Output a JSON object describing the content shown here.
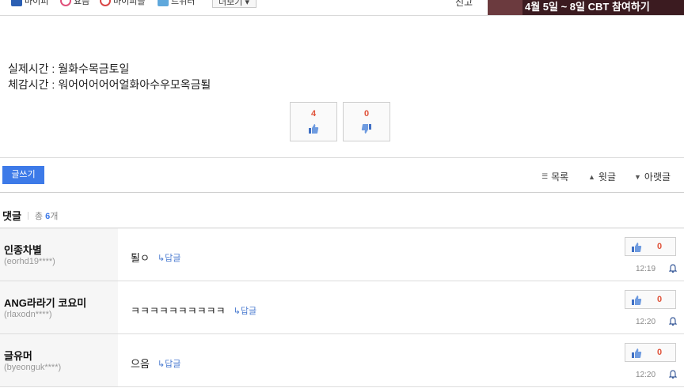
{
  "share_bar": {
    "items": [
      "마이피",
      "요즘",
      "마이피플",
      "트위터"
    ],
    "more_label": "더보기",
    "report_label": "신고"
  },
  "banner": {
    "text": "4월 5일 ~ 8일 CBT 참여하기"
  },
  "post": {
    "lines": [
      "실제시간 : 월화수목금토일",
      "체감시간 : 워어어어어어얼화아수우모옥금퇼"
    ]
  },
  "votes": {
    "up": "4",
    "down": "0"
  },
  "toolbar": {
    "write_label": "글쓰기",
    "list_label": "목록",
    "prev_label": "윗글",
    "next_label": "아랫글"
  },
  "comments_header": {
    "title": "댓글",
    "total_prefix": "총",
    "count": "6",
    "unit": "개"
  },
  "comments": [
    {
      "nick": "인종차별",
      "uid": "(eorhd19****)",
      "text": "퇼ㅇ",
      "reply": "↳답글",
      "likes": "0",
      "time": "12:19"
    },
    {
      "nick": "ANG라라기 코요미",
      "uid": "(rlaxodn****)",
      "text": "ㅋㅋㅋㅋㅋㅋㅋㅋㅋㅋ",
      "reply": "↳답글",
      "likes": "0",
      "time": "12:20"
    },
    {
      "nick": "글유머",
      "uid": "(byeonguk****)",
      "text": "으음",
      "reply": "↳답글",
      "likes": "0",
      "time": "12:20"
    }
  ],
  "colors": {
    "accent": "#3d7ae8",
    "vote_count": "#e0533a",
    "banner_bg": "#3b1b20"
  },
  "icons": {
    "like": "thumb-up-icon",
    "dislike": "thumb-down-icon",
    "notify": "bell-icon"
  }
}
